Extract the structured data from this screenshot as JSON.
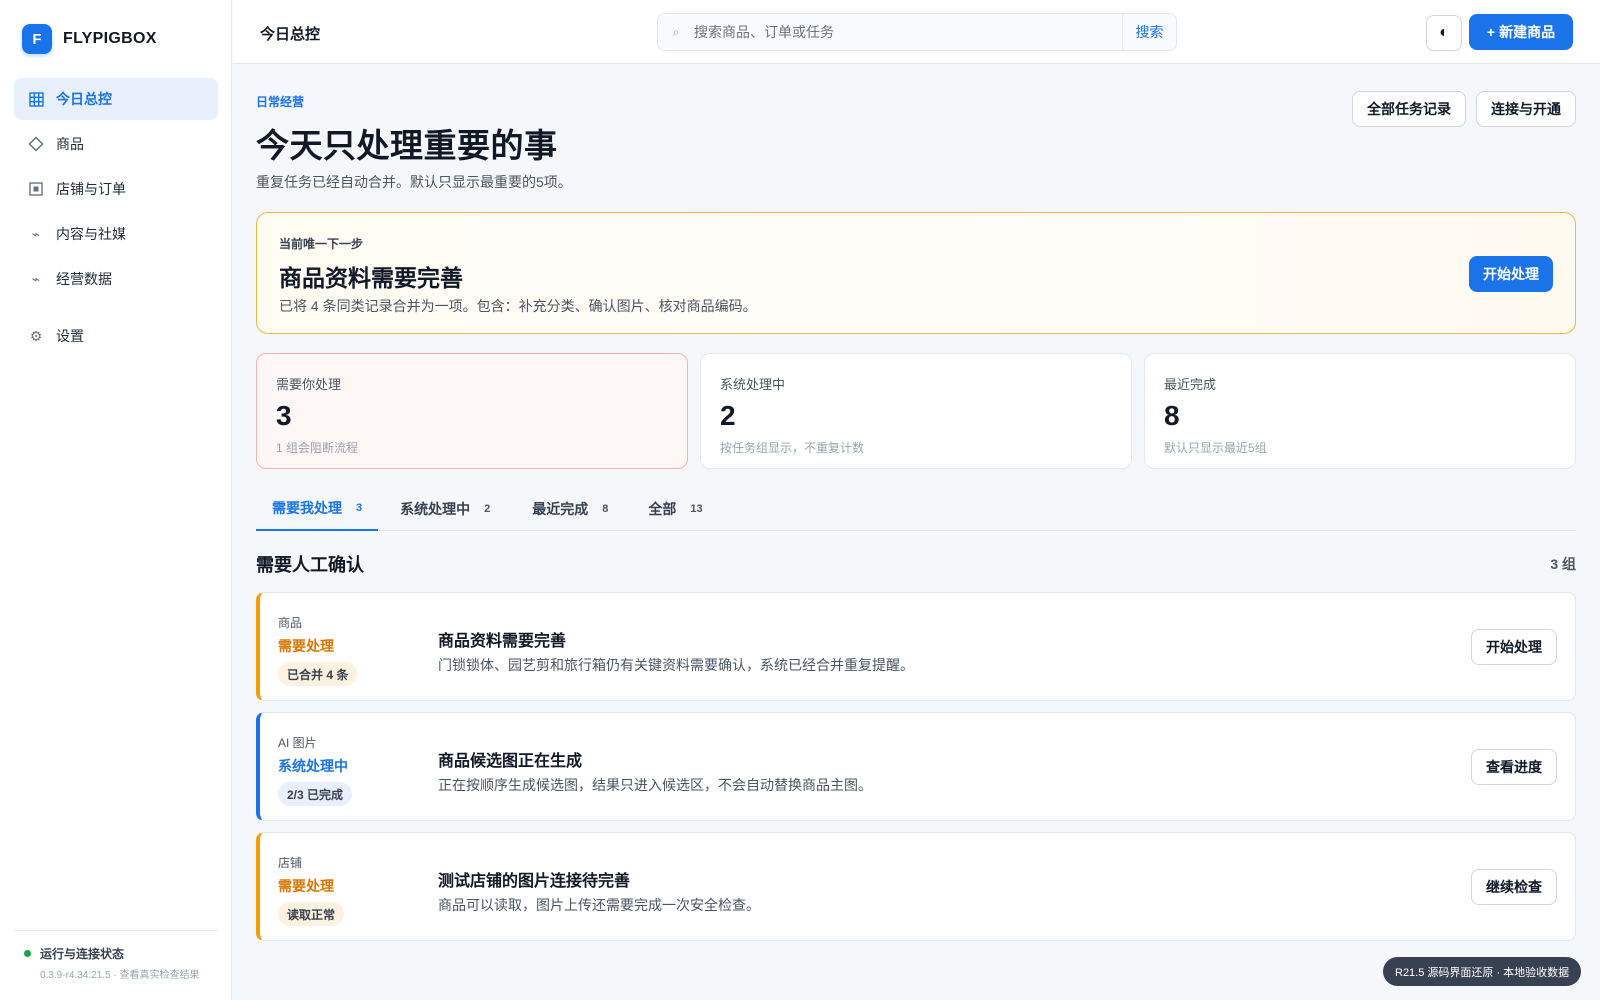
{
  "brand": {
    "logo_letter": "F",
    "name": "FLYPIGBOX",
    "accent": "#1a73e8"
  },
  "sidebar": {
    "items": [
      {
        "label": "今日总控",
        "icon": "grid-icon",
        "active": true
      },
      {
        "label": "商品",
        "icon": "diamond-icon",
        "active": false
      },
      {
        "label": "店铺与订单",
        "icon": "store-icon",
        "active": false
      },
      {
        "label": "内容与社媒",
        "icon": "content-icon",
        "active": false
      },
      {
        "label": "经营数据",
        "icon": "chart-icon",
        "active": false
      }
    ],
    "settings": {
      "label": "设置",
      "icon": "gear-icon"
    },
    "status": {
      "title": "运行与连接状态",
      "detail": "0.3.9-r4.34.21.5 · 查看真实检查结果",
      "color": "#16a34a"
    }
  },
  "topbar": {
    "title": "今日总控",
    "search": {
      "placeholder": "搜索商品、订单或任务",
      "value": "",
      "button": "搜索"
    },
    "theme_toggle_icon": "contrast-icon",
    "new_button": {
      "icon": "+",
      "label": "新建商品"
    }
  },
  "header": {
    "eyebrow": "日常经营",
    "title": "今天只处理重要的事",
    "subtitle": "重复任务已经自动合并。默认只显示最重要的5项。",
    "actions": [
      "全部任务记录",
      "连接与开通"
    ]
  },
  "hero": {
    "eyebrow": "当前唯一下一步",
    "title": "商品资料需要完善",
    "desc": "已将 4 条同类记录合并为一项。包含：补充分类、确认图片、核对商品编码。",
    "button": "开始处理"
  },
  "stats": [
    {
      "label": "需要你处理",
      "value": "3",
      "note": "1 组会阻断流程",
      "alert": true
    },
    {
      "label": "系统处理中",
      "value": "2",
      "note": "按任务组显示，不重复计数",
      "alert": false
    },
    {
      "label": "最近完成",
      "value": "8",
      "note": "默认只显示最近5组",
      "alert": false
    }
  ],
  "tabs": [
    {
      "label": "需要我处理",
      "count": "3",
      "active": true
    },
    {
      "label": "系统处理中",
      "count": "2",
      "active": false
    },
    {
      "label": "最近完成",
      "count": "8",
      "active": false
    },
    {
      "label": "全部",
      "count": "13",
      "active": false
    }
  ],
  "section": {
    "title": "需要人工确认",
    "count": "3 组"
  },
  "tasks": [
    {
      "category": "商品",
      "state": "需要处理",
      "pill": "已合并 4 条",
      "title": "商品资料需要完善",
      "desc": "门锁锁体、园艺剪和旅行箱仍有关键资料需要确认，系统已经合并重复提醒。",
      "button": "开始处理",
      "tone": "warning"
    },
    {
      "category": "AI 图片",
      "state": "系统处理中",
      "pill": "2/3 已完成",
      "title": "商品候选图正在生成",
      "desc": "正在按顺序生成候选图，结果只进入候选区，不会自动替换商品主图。",
      "button": "查看进度",
      "tone": "info"
    },
    {
      "category": "店铺",
      "state": "需要处理",
      "pill": "读取正常",
      "title": "测试店铺的图片连接待完善",
      "desc": "商品可以读取，图片上传还需要完成一次安全检查。",
      "button": "继续检查",
      "tone": "warning"
    }
  ],
  "footer_badge": "R21.5 源码界面还原 · 本地验收数据"
}
